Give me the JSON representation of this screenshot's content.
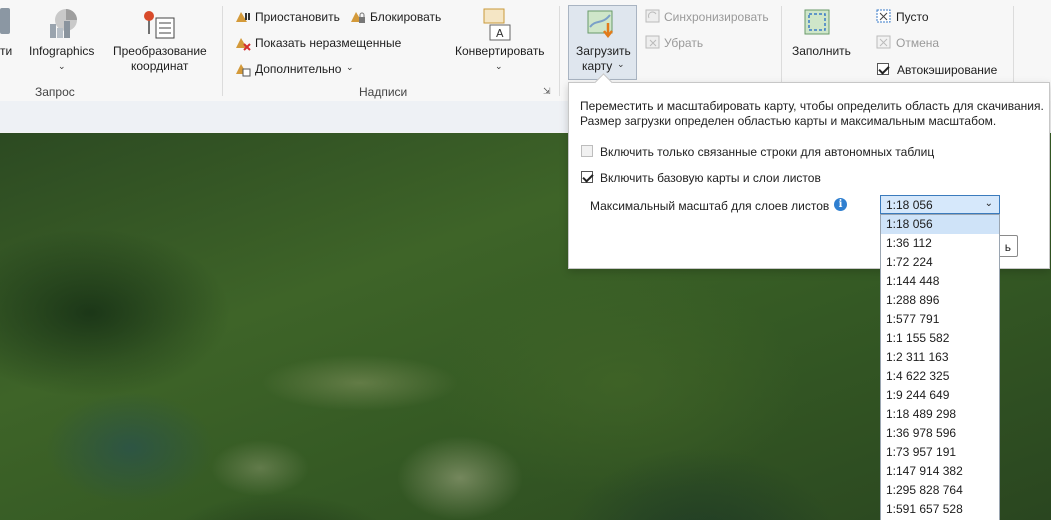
{
  "ribbon": {
    "partial_left": "ти",
    "infographics": "Infographics",
    "convert_coords_line1": "Преобразование",
    "convert_coords_line2": "координат",
    "group_query": "Запрос",
    "pause": "Приостановить",
    "lock": "Блокировать",
    "show_unplaced": "Показать неразмещенные",
    "more": "Дополнительно",
    "convert": "Конвертировать",
    "group_labels": "Надписи",
    "download_map_line1": "Загрузить",
    "download_map_line2": "карту",
    "sync": "Синхронизировать",
    "remove": "Убрать",
    "fill": "Заполнить",
    "empty": "Пусто",
    "cancel": "Отмена",
    "autocache": "Автокэширование"
  },
  "popup": {
    "description_line1": "Переместить и масштабировать карту, чтобы определить область для скачивания.",
    "description_line2": "Размер загрузки определен областью карты и максимальным масштабом.",
    "option_related_rows": "Включить только связанные строки для автономных таблиц",
    "option_basemap": "Включить базовую карты и слои  листов",
    "max_scale_label": "Максимальный масштаб для слоев листов",
    "hidden_button_tail": "ь",
    "select_value": "1:18 056",
    "scale_options": [
      "1:18 056",
      "1:36 112",
      "1:72 224",
      "1:144 448",
      "1:288 896",
      "1:577 791",
      "1:1 155 582",
      "1:2 311 163",
      "1:4 622 325",
      "1:9 244 649",
      "1:18 489 298",
      "1:36 978 596",
      "1:73 957 191",
      "1:147 914 382",
      "1:295 828 764",
      "1:591 657 528"
    ]
  }
}
